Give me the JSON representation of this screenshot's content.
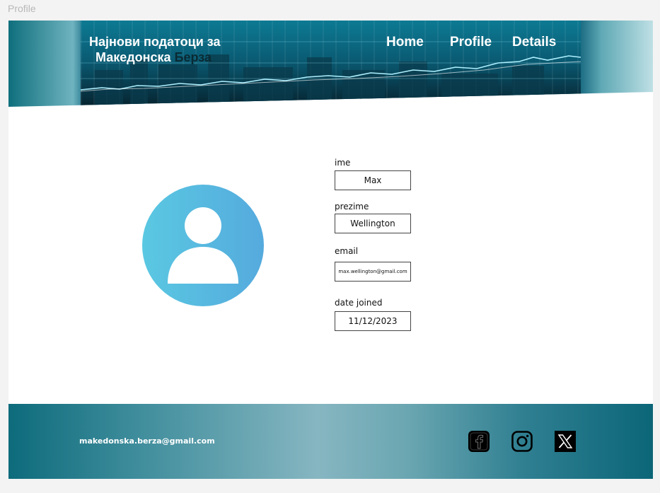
{
  "frame": {
    "label": "Profile"
  },
  "header": {
    "title_line1": "Најнови податоци за",
    "title_line2_light": "Македонска",
    "title_line2_dark": "Берза",
    "nav": [
      "Home",
      "Profile",
      "Details"
    ]
  },
  "profile": {
    "avatar_icon": "user-silhouette-icon",
    "fields": [
      {
        "label": "ime",
        "value": "Max"
      },
      {
        "label": "prezime",
        "value": "Wellington"
      },
      {
        "label": "email",
        "value": "max.wellington@gmail.com"
      },
      {
        "label": "date joined",
        "value": "11/12/2023"
      }
    ]
  },
  "footer": {
    "email": "makedonska.berza@gmail.com",
    "social_icons": [
      "facebook-icon",
      "instagram-icon",
      "x-icon"
    ]
  },
  "colors": {
    "header_dark": "#0b5a72",
    "avatar_start": "#5ac8e2",
    "avatar_end": "#55aadd",
    "footer_light": "#86b6c1"
  }
}
